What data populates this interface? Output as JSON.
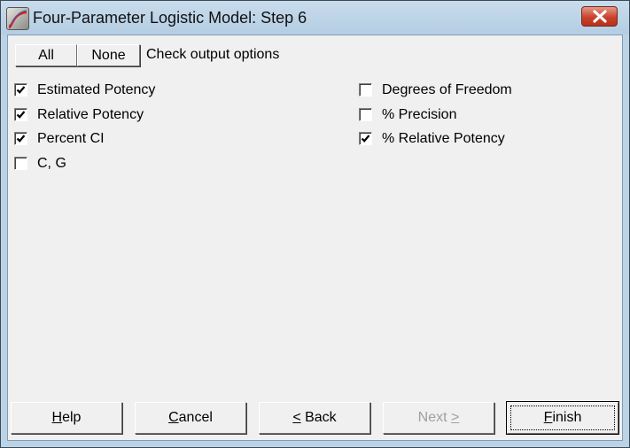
{
  "window": {
    "title": "Four-Parameter Logistic Model: Step 6",
    "icon": "app-logistic-curve-icon",
    "close_icon": "close-icon"
  },
  "toolbar": {
    "all_label": "All",
    "none_label": "None",
    "instruction": "Check output options"
  },
  "options_left": [
    {
      "label": "Estimated Potency",
      "checked": true
    },
    {
      "label": "Relative Potency",
      "checked": true
    },
    {
      "label": "Percent CI",
      "checked": true
    },
    {
      "label": "C, G",
      "checked": false
    }
  ],
  "options_right": [
    {
      "label": "Degrees of Freedom",
      "checked": false
    },
    {
      "label": "% Precision",
      "checked": false
    },
    {
      "label": "% Relative Potency",
      "checked": true
    }
  ],
  "footer": {
    "help": {
      "mnemonic": "H",
      "rest": "elp",
      "enabled": true
    },
    "cancel": {
      "mnemonic": "C",
      "rest": "ancel",
      "enabled": true
    },
    "back": {
      "mnemonic": "<",
      "rest": " Back",
      "enabled": true
    },
    "next": {
      "prefix": "Next ",
      "mnemonic": ">",
      "enabled": false
    },
    "finish": {
      "mnemonic": "F",
      "rest": "inish",
      "enabled": true,
      "default": true
    }
  }
}
